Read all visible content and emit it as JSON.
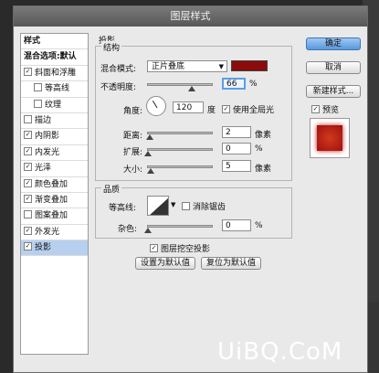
{
  "dialog": {
    "title": "图层样式"
  },
  "sidebar": {
    "items": [
      {
        "label": "样式",
        "checkbox": false,
        "checked": false,
        "indent": false,
        "header": true
      },
      {
        "label": "混合选项:默认",
        "checkbox": false,
        "checked": false,
        "indent": false,
        "header": true
      },
      {
        "label": "斜面和浮雕",
        "checkbox": true,
        "checked": true,
        "indent": false
      },
      {
        "label": "等高线",
        "checkbox": true,
        "checked": false,
        "indent": true
      },
      {
        "label": "纹理",
        "checkbox": true,
        "checked": false,
        "indent": true
      },
      {
        "label": "描边",
        "checkbox": true,
        "checked": false,
        "indent": false
      },
      {
        "label": "内阴影",
        "checkbox": true,
        "checked": true,
        "indent": false
      },
      {
        "label": "内发光",
        "checkbox": true,
        "checked": true,
        "indent": false
      },
      {
        "label": "光泽",
        "checkbox": true,
        "checked": true,
        "indent": false
      },
      {
        "label": "颜色叠加",
        "checkbox": true,
        "checked": true,
        "indent": false
      },
      {
        "label": "渐变叠加",
        "checkbox": true,
        "checked": true,
        "indent": false
      },
      {
        "label": "图案叠加",
        "checkbox": true,
        "checked": false,
        "indent": false
      },
      {
        "label": "外发光",
        "checkbox": true,
        "checked": true,
        "indent": false
      },
      {
        "label": "投影",
        "checkbox": true,
        "checked": true,
        "indent": false,
        "selected": true
      }
    ]
  },
  "drop_shadow": {
    "section_title": "投影",
    "structure": {
      "title": "结构",
      "blend_mode_label": "混合模式:",
      "blend_mode_value": "正片叠底",
      "shadow_color": "#8c0b0b",
      "opacity_label": "不透明度:",
      "opacity_value": "66",
      "opacity_unit": "%",
      "angle_label": "角度:",
      "angle_value": "120",
      "angle_unit": "度",
      "global_light_label": "使用全局光",
      "global_light_checked": true,
      "distance_label": "距离:",
      "distance_value": "2",
      "distance_unit": "像素",
      "spread_label": "扩展:",
      "spread_value": "0",
      "spread_unit": "%",
      "size_label": "大小:",
      "size_value": "5",
      "size_unit": "像素"
    },
    "quality": {
      "title": "品质",
      "contour_label": "等高线:",
      "anti_alias_label": "消除锯齿",
      "anti_alias_checked": false,
      "noise_label": "杂色:",
      "noise_value": "0",
      "noise_unit": "%"
    },
    "knockout_label": "图层挖空投影",
    "knockout_checked": true,
    "make_default_label": "设置为默认值",
    "reset_default_label": "复位为默认值"
  },
  "buttons": {
    "ok": "确定",
    "cancel": "取消",
    "new_style": "新建样式...",
    "preview_label": "预览",
    "preview_checked": true
  },
  "watermark": "UiBQ.CoM"
}
